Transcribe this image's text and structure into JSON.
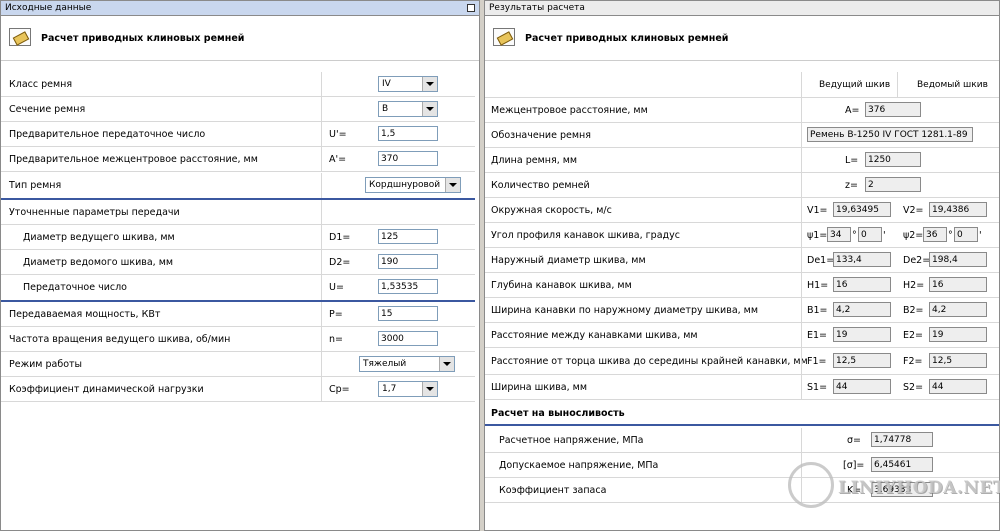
{
  "left": {
    "panel_title": "Исходные данные",
    "header_title": "Расчет приводных клиновых ремней",
    "rows": [
      {
        "label": "Класс ремня",
        "sym": "",
        "value": "IV",
        "kind": "select"
      },
      {
        "label": "Сечение ремня",
        "sym": "",
        "value": "В",
        "kind": "select"
      },
      {
        "label": "Предварительное передаточное число",
        "sym": "U'=",
        "value": "1,5",
        "kind": "input"
      },
      {
        "label": "Предварительное межцентровое расстояние, мм",
        "sym": "A'=",
        "value": "370",
        "kind": "input"
      },
      {
        "label": "Тип ремня",
        "sym": "",
        "value": "Кордшнуровой",
        "kind": "select"
      },
      {
        "label": "Уточненные параметры передачи",
        "sym": "",
        "value": "",
        "kind": "section"
      },
      {
        "label": "Диаметр ведущего шкива, мм",
        "sym": "D1=",
        "value": "125",
        "kind": "input"
      },
      {
        "label": "Диаметр ведомого шкива, мм",
        "sym": "D2=",
        "value": "190",
        "kind": "input"
      },
      {
        "label": "Передаточное число",
        "sym": "U=",
        "value": "1,53535",
        "kind": "input"
      },
      {
        "label": "Передаваемая мощность, КВт",
        "sym": "P=",
        "value": "15",
        "kind": "input"
      },
      {
        "label": "Частота вращения ведущего шкива, об/мин",
        "sym": "n=",
        "value": "3000",
        "kind": "input"
      },
      {
        "label": "Режим работы",
        "sym": "",
        "value": "Тяжелый",
        "kind": "select"
      },
      {
        "label": "Коэффициент динамической нагрузки",
        "sym": "Cp=",
        "value": "1,7",
        "kind": "select"
      }
    ]
  },
  "right": {
    "panel_title": "Результаты расчета",
    "header_title": "Расчет приводных клиновых ремней",
    "col_driver": "Ведущий шкив",
    "col_driven": "Ведомый шкив",
    "rows": [
      {
        "label": "Межцентровое расстояние, мм",
        "sym": "A=",
        "value": "376"
      },
      {
        "label": "Обозначение ремня",
        "value": "Ремень В-1250 IV ГОСТ 1281.1-89"
      },
      {
        "label": "Длина ремня, мм",
        "sym": "L=",
        "value": "1250"
      },
      {
        "label": "Количество ремней",
        "sym": "z=",
        "value": "2"
      },
      {
        "label": "Окружная скорость, м/с",
        "sym1": "V1=",
        "v1": "19,63495",
        "sym2": "V2=",
        "v2": "19,4386"
      },
      {
        "label": "Угол профиля канавок шкива, градус",
        "sym1": "ψ1=",
        "deg1": "34",
        "min1": "0",
        "sym2": "ψ2=",
        "deg2": "36",
        "min2": "0",
        "deg_sign": "°",
        "min_sign": "'"
      },
      {
        "label": "Наружный диаметр шкива, мм",
        "sym1": "De1=",
        "v1": "133,4",
        "sym2": "De2=",
        "v2": "198,4"
      },
      {
        "label": "Глубина канавок шкива, мм",
        "sym1": "H1=",
        "v1": "16",
        "sym2": "H2=",
        "v2": "16"
      },
      {
        "label": "Ширина канавки по наружному диаметру шкива, мм",
        "sym1": "B1=",
        "v1": "4,2",
        "sym2": "B2=",
        "v2": "4,2"
      },
      {
        "label": "Расстояние между канавками шкива, мм",
        "sym1": "E1=",
        "v1": "19",
        "sym2": "E2=",
        "v2": "19"
      },
      {
        "label": "Расстояние от торца шкива до середины крайней канавки, мм",
        "sym1": "F1=",
        "v1": "12,5",
        "sym2": "F2=",
        "v2": "12,5"
      },
      {
        "label": "Ширина шкива, мм",
        "sym1": "S1=",
        "v1": "44",
        "sym2": "S2=",
        "v2": "44"
      }
    ],
    "endurance": {
      "title": "Расчет на выносливость",
      "rows": [
        {
          "label": "Расчетное напряжение, МПа",
          "sym": "σ=",
          "value": "1,74778"
        },
        {
          "label": "Допускаемое напряжение, МПа",
          "sym": "[σ]=",
          "value": "6,45461"
        },
        {
          "label": "Коэффициент запаса",
          "sym": "K=",
          "value": "3,69333"
        }
      ]
    }
  },
  "watermark": {
    "text": "LINIYHODA.NET"
  },
  "colors": {
    "left_title_bg": "#c9d7ee",
    "section_line": "#3b58a0",
    "input_border": "#7f9db9"
  }
}
